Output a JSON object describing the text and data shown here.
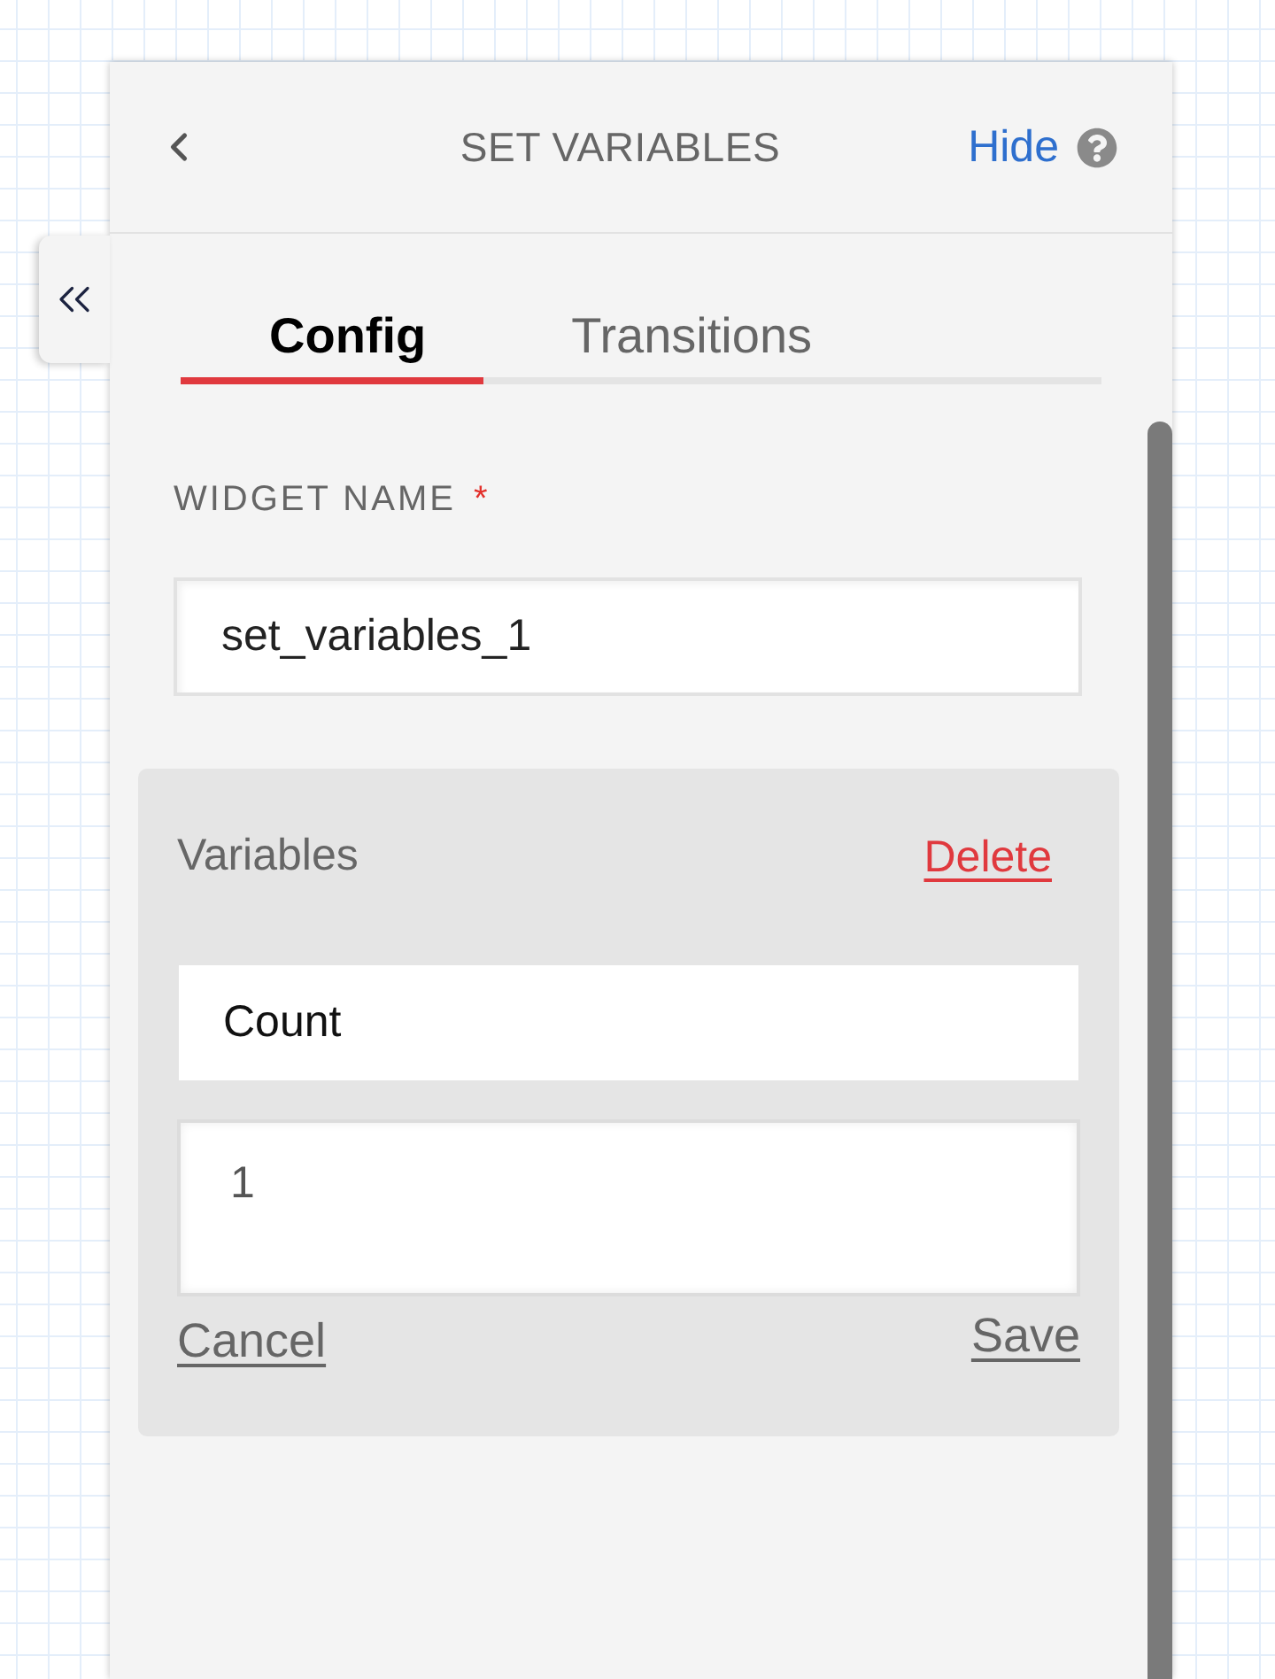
{
  "panel": {
    "title": "SET VARIABLES",
    "hide_link": "Hide"
  },
  "tabs": [
    {
      "label": "Config",
      "selected": true
    },
    {
      "label": "Transitions",
      "selected": false
    }
  ],
  "widget_name": {
    "label": "WIDGET NAME",
    "required_mark": "*",
    "value": "set_variables_1"
  },
  "variables": {
    "title": "Variables",
    "delete_link": "Delete",
    "name_value": "Count",
    "value_value": "1",
    "cancel_link": "Cancel",
    "save_link": "Save"
  }
}
